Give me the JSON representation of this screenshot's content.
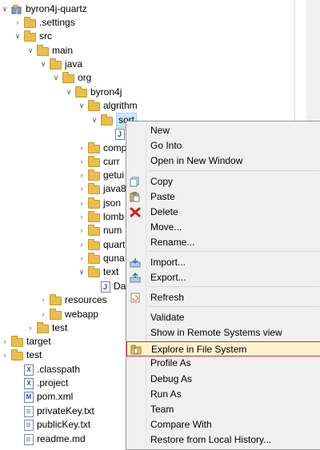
{
  "tree": [
    {
      "label": "byron4j-quartz",
      "icon": "project-icon",
      "toggle": "open"
    },
    {
      "label": ".settings",
      "icon": "folder-icon",
      "toggle": "closed"
    },
    {
      "label": "src",
      "icon": "folder-icon",
      "toggle": "open"
    },
    {
      "label": "main",
      "icon": "folder-icon",
      "toggle": "open"
    },
    {
      "label": "java",
      "icon": "folder-icon",
      "toggle": "open"
    },
    {
      "label": "org",
      "icon": "folder-icon",
      "toggle": "open"
    },
    {
      "label": "byron4j",
      "icon": "folder-icon",
      "toggle": "open"
    },
    {
      "label": "algrithm",
      "icon": "folder-icon",
      "toggle": "open"
    },
    {
      "label": "sort",
      "icon": "folder-icon",
      "toggle": "open",
      "selected": true
    },
    {
      "label": "",
      "icon": "java-file-icon",
      "toggle": "none"
    },
    {
      "label": "comp",
      "icon": "folder-icon",
      "toggle": "closed"
    },
    {
      "label": "curr",
      "icon": "folder-icon",
      "toggle": "closed"
    },
    {
      "label": "getui",
      "icon": "folder-icon",
      "toggle": "closed"
    },
    {
      "label": "java8",
      "icon": "folder-icon",
      "toggle": "closed"
    },
    {
      "label": "json",
      "icon": "folder-icon",
      "toggle": "closed"
    },
    {
      "label": "lomb",
      "icon": "folder-icon",
      "toggle": "closed"
    },
    {
      "label": "num",
      "icon": "folder-icon",
      "toggle": "closed"
    },
    {
      "label": "quart",
      "icon": "folder-icon",
      "toggle": "closed"
    },
    {
      "label": "quna",
      "icon": "folder-icon",
      "toggle": "closed"
    },
    {
      "label": "text",
      "icon": "folder-icon",
      "toggle": "open"
    },
    {
      "label": "Da",
      "icon": "java-file-icon",
      "toggle": "none"
    },
    {
      "label": "resources",
      "icon": "folder-icon",
      "toggle": "closed"
    },
    {
      "label": "webapp",
      "icon": "folder-icon",
      "toggle": "closed"
    },
    {
      "label": "test",
      "icon": "folder-icon",
      "toggle": "closed"
    },
    {
      "label": "target",
      "icon": "folder-icon",
      "toggle": "closed"
    },
    {
      "label": "test",
      "icon": "folder-icon",
      "toggle": "closed"
    },
    {
      "label": ".classpath",
      "icon": "x-file-icon",
      "toggle": "none"
    },
    {
      "label": ".project",
      "icon": "x-file-icon",
      "toggle": "none"
    },
    {
      "label": "pom.xml",
      "icon": "m-file-icon",
      "toggle": "none"
    },
    {
      "label": "privateKey.txt",
      "icon": "text-file-icon",
      "toggle": "none"
    },
    {
      "label": "publicKey.txt",
      "icon": "text-file-icon",
      "toggle": "none"
    },
    {
      "label": "readme.md",
      "icon": "text-file-icon",
      "toggle": "none"
    }
  ],
  "menu": {
    "items": [
      {
        "label": "New",
        "icon": ""
      },
      {
        "label": "Go Into",
        "icon": ""
      },
      {
        "label": "Open in New Window",
        "icon": ""
      },
      {
        "label": "Copy",
        "icon": "copy-icon"
      },
      {
        "label": "Paste",
        "icon": "paste-icon"
      },
      {
        "label": "Delete",
        "icon": "delete-icon"
      },
      {
        "label": "Move...",
        "icon": ""
      },
      {
        "label": "Rename...",
        "icon": ""
      },
      {
        "label": "Import...",
        "icon": "import-icon"
      },
      {
        "label": "Export...",
        "icon": "export-icon"
      },
      {
        "label": "Refresh",
        "icon": "refresh-icon"
      },
      {
        "label": "Validate",
        "icon": ""
      },
      {
        "label": "Show in Remote Systems view",
        "icon": ""
      },
      {
        "label": "Explore in File System",
        "icon": "explore-icon",
        "highlighted": true
      },
      {
        "label": "Profile As",
        "icon": ""
      },
      {
        "label": "Debug As",
        "icon": ""
      },
      {
        "label": "Run As",
        "icon": ""
      },
      {
        "label": "Team",
        "icon": ""
      },
      {
        "label": "Compare With",
        "icon": ""
      },
      {
        "label": "Restore from Local History...",
        "icon": ""
      }
    ]
  },
  "colors": {
    "highlight_border": "#c63031",
    "menu_bg": "#f0f0f0",
    "selection": "#cde8ff"
  }
}
